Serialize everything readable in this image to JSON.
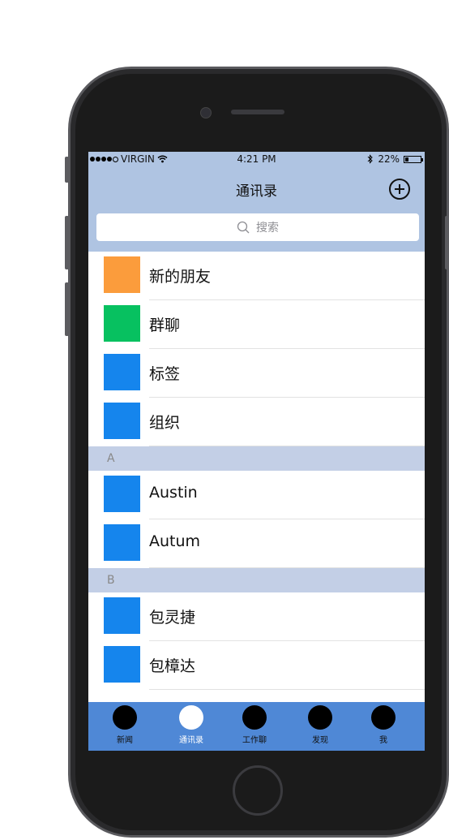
{
  "status": {
    "carrier": "VIRGIN",
    "time": "4:21 PM",
    "battery": "22%",
    "battery_level": 0.22
  },
  "nav": {
    "title": "通讯录",
    "add_icon": "plus-circle-icon"
  },
  "search": {
    "placeholder": "搜索"
  },
  "top_items": [
    {
      "label": "新的朋友",
      "color": "#fb9c3c"
    },
    {
      "label": "群聊",
      "color": "#07c160"
    },
    {
      "label": "标签",
      "color": "#1585ed"
    },
    {
      "label": "组织",
      "color": "#1585ed"
    }
  ],
  "sections": [
    {
      "letter": "A",
      "contacts": [
        "Austin",
        "Autum"
      ]
    },
    {
      "letter": "B",
      "contacts": [
        "包灵捷",
        "包樟达"
      ]
    }
  ],
  "contact_color": "#1585ed",
  "tabs": [
    {
      "label": "新闻",
      "active": false
    },
    {
      "label": "通讯录",
      "active": true
    },
    {
      "label": "工作聊",
      "active": false
    },
    {
      "label": "发现",
      "active": false
    },
    {
      "label": "我",
      "active": false
    }
  ],
  "colors": {
    "nav_bg": "#afc4e2",
    "section_bg": "#c3cfe6",
    "tabbar_bg": "#4f88d6"
  }
}
